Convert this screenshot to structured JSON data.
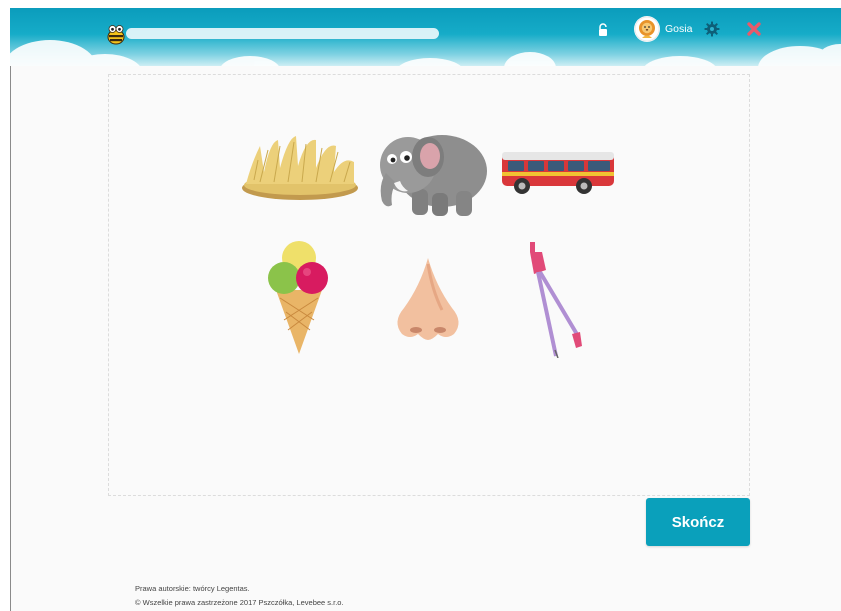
{
  "header": {
    "user_name": "Gosia",
    "progress": 0,
    "icons": [
      "bee-logo-icon",
      "unlock-icon",
      "avatar-lion-icon",
      "gear-icon",
      "close-icon"
    ],
    "colors": {
      "bar": "#0b9cbc",
      "close": "#e85a6a"
    }
  },
  "board": {
    "pictures": [
      {
        "name": "hay-icon"
      },
      {
        "name": "elephant-icon"
      },
      {
        "name": "bus-icon"
      },
      {
        "name": "ice-cream-icon"
      },
      {
        "name": "nose-icon"
      },
      {
        "name": "compass-icon"
      }
    ]
  },
  "actions": {
    "finish_label": "Skończ"
  },
  "footer": {
    "line1": "Prawa autorskie: twórcy Legentas.",
    "line2": "© Wszelkie prawa zastrzeżone 2017 Pszczółka, Levebee s.r.o."
  }
}
